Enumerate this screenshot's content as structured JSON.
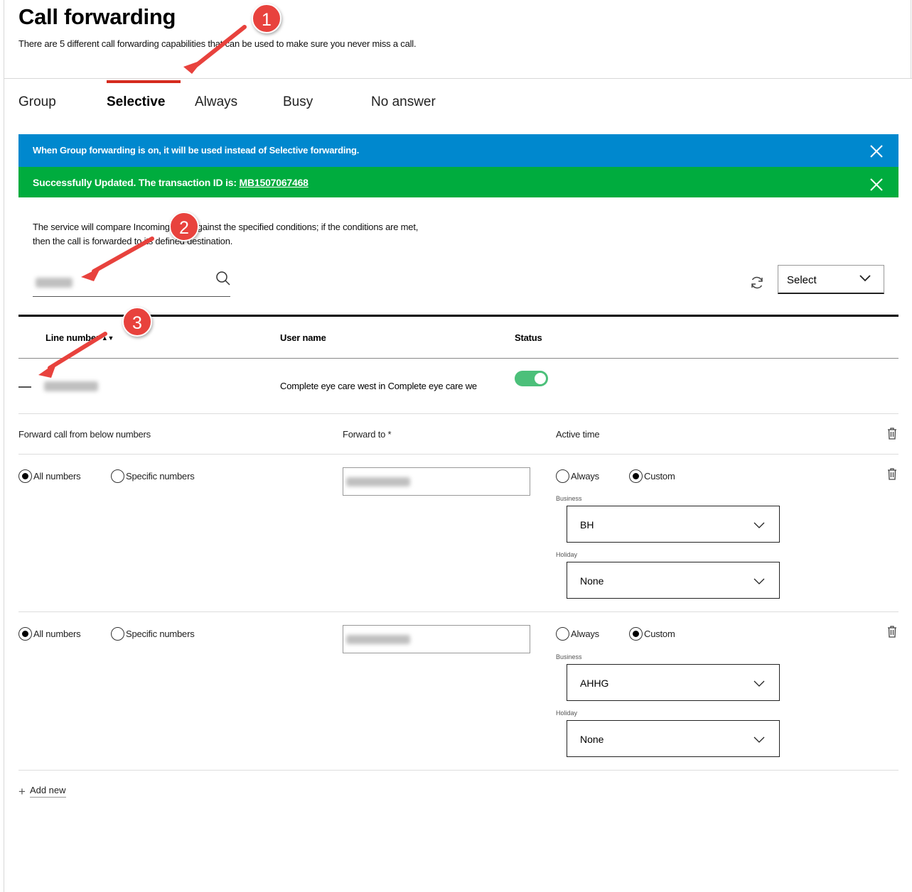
{
  "page": {
    "title": "Call forwarding",
    "subtitle": "There are 5 different call forwarding capabilities that can be used to make sure you never miss a call."
  },
  "tabs": [
    {
      "label": "Group",
      "active": false
    },
    {
      "label": "Selective",
      "active": true
    },
    {
      "label": "Always",
      "active": false
    },
    {
      "label": "Busy",
      "active": false
    },
    {
      "label": "No answer",
      "active": false
    }
  ],
  "banners": {
    "info": "When Group forwarding is on, it will be used instead of Selective forwarding.",
    "success_prefix": "Successfully Updated.  The transaction ID is: ",
    "success_link": "MB1507067468",
    "info_color": "#0088ce",
    "success_color": "#00ac3e"
  },
  "description": "The service will compare Incoming calls against the specified conditions; if the conditions are met, then the call is forwarded to its defined destination.",
  "filter": {
    "select_label": "Select"
  },
  "table": {
    "headers": {
      "line_number": "Line number",
      "user_name": "User name",
      "status": "Status"
    },
    "row": {
      "user_name": "Complete eye care west in Complete eye care we",
      "status_on": true
    }
  },
  "rules_header": {
    "from": "Forward call from below numbers",
    "to": "Forward to *",
    "active_time": "Active time"
  },
  "rules": [
    {
      "from_options": [
        "All numbers",
        "Specific numbers"
      ],
      "from_selected": "All numbers",
      "time_options": [
        "Always",
        "Custom"
      ],
      "time_selected": "Custom",
      "business_label": "Business",
      "business_value": "BH",
      "holiday_label": "Holiday",
      "holiday_value": "None"
    },
    {
      "from_options": [
        "All numbers",
        "Specific numbers"
      ],
      "from_selected": "All numbers",
      "time_options": [
        "Always",
        "Custom"
      ],
      "time_selected": "Custom",
      "business_label": "Business",
      "business_value": "AHHG",
      "holiday_label": "Holiday",
      "holiday_value": "None"
    }
  ],
  "add_new": "Add new",
  "annotations": [
    "1",
    "2",
    "3"
  ],
  "accent_color": "#d52b1e",
  "annotation_color": "#e8423d"
}
